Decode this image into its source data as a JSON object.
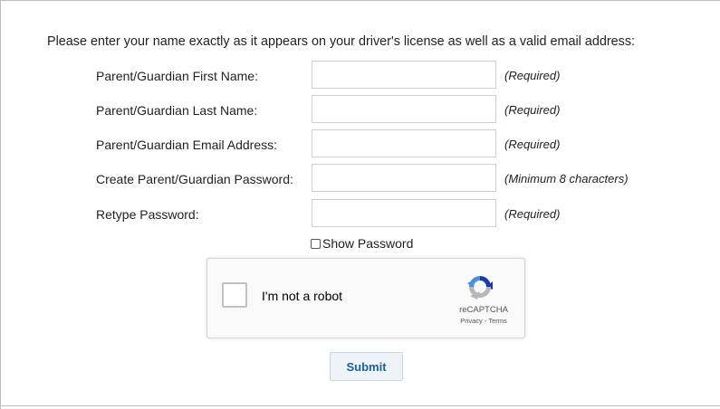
{
  "form": {
    "intro": "Please enter your name exactly as it appears on your driver's license as well as a valid email address:",
    "fields": [
      {
        "label": "Parent/Guardian First Name:",
        "value": "",
        "hint": "(Required)"
      },
      {
        "label": "Parent/Guardian Last Name:",
        "value": "",
        "hint": "(Required)"
      },
      {
        "label": "Parent/Guardian Email Address:",
        "value": "",
        "hint": "(Required)"
      },
      {
        "label": "Create Parent/Guardian Password:",
        "value": "",
        "hint": "(Minimum 8 characters)"
      },
      {
        "label": "Retype Password:",
        "value": "",
        "hint": "(Required)"
      }
    ],
    "show_password": {
      "label": "Show Password",
      "checked": false
    },
    "submit_label": "Submit"
  },
  "captcha": {
    "checkbox_label": "I'm not a robot",
    "brand": "reCAPTCHA",
    "links": "Privacy - Terms",
    "icon": "recaptcha-logo-icon",
    "checked": false
  },
  "colors": {
    "submit_text": "#1d5f97",
    "submit_bg": "#eef3f8",
    "captcha_bg": "#f9f9f9",
    "recaptcha_blue": "#4a90e2",
    "recaptcha_dark": "#1c3aa9",
    "recaptcha_gray": "#b7b7b7"
  }
}
